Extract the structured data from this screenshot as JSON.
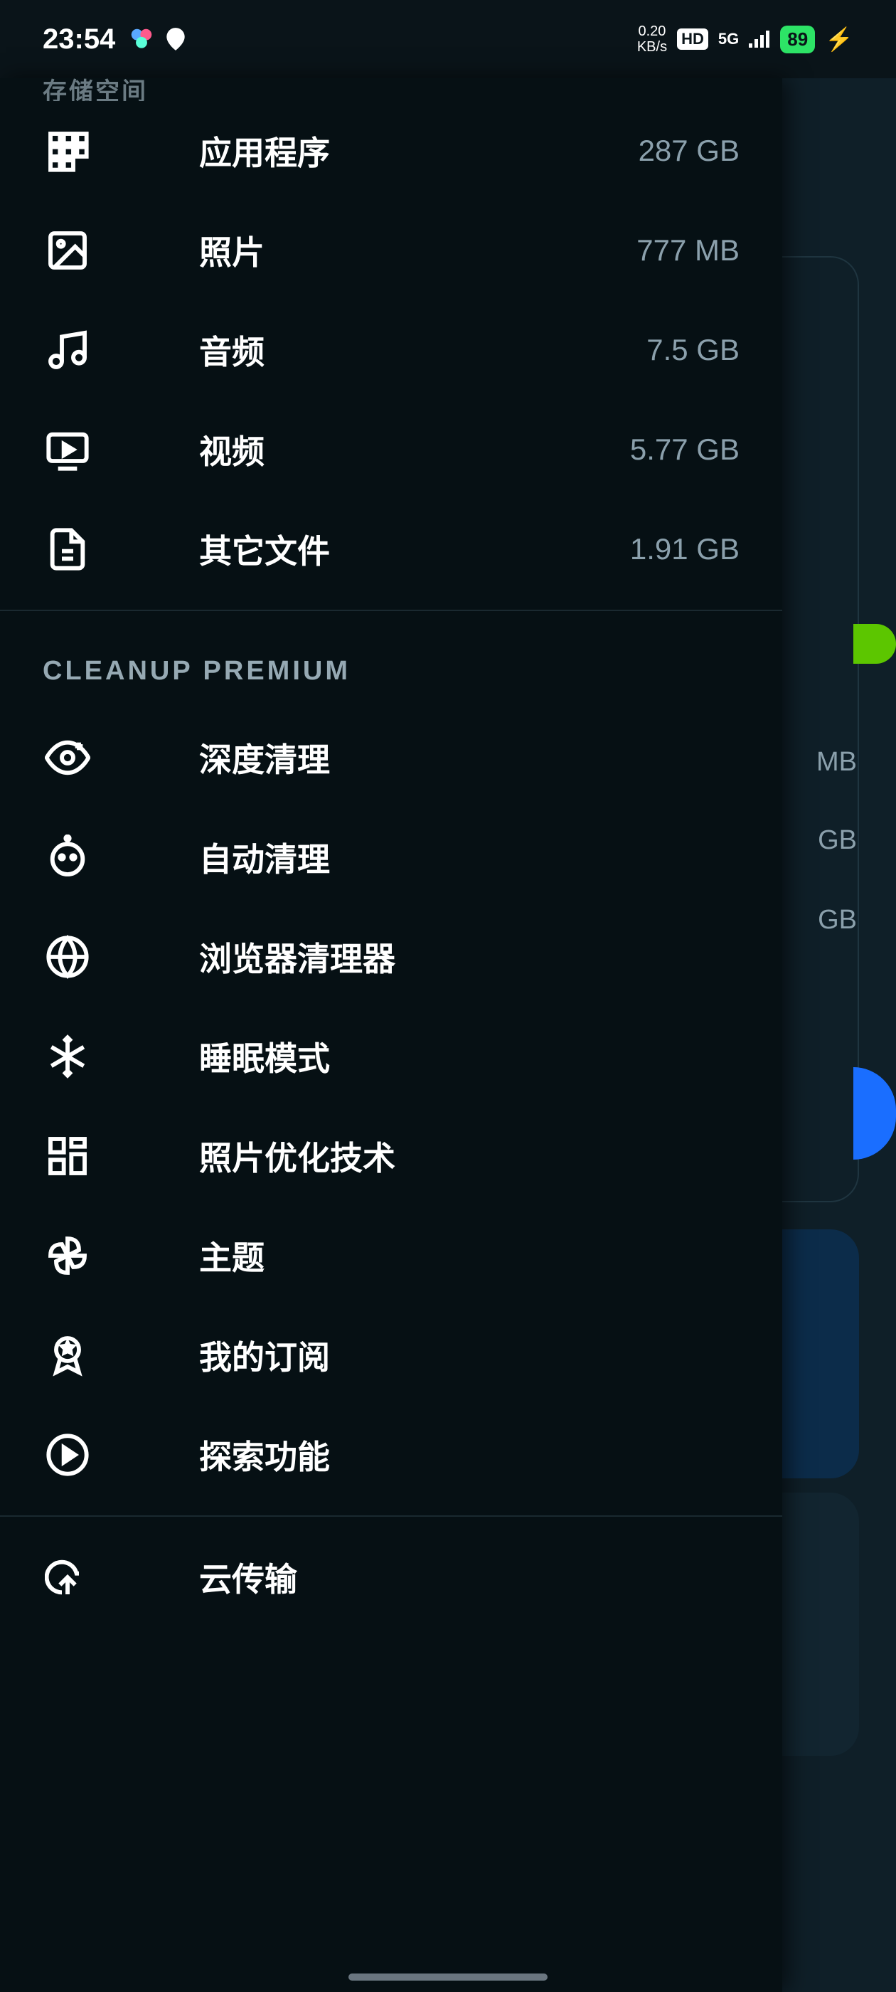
{
  "status_bar": {
    "time": "23:54",
    "speed_upper": "0.20",
    "speed_lower": "KB/s",
    "hd": "HD",
    "network": "5G",
    "battery": "89"
  },
  "background": {
    "text1": "MB",
    "text2": "GB",
    "text3": "GB"
  },
  "drawer": {
    "section_cut": "存储空间",
    "storage_items": [
      {
        "icon": "apps",
        "label": "应用程序",
        "value": "287 GB"
      },
      {
        "icon": "photo",
        "label": "照片",
        "value": "777 MB"
      },
      {
        "icon": "audio",
        "label": "音频",
        "value": "7.5 GB"
      },
      {
        "icon": "video",
        "label": "视频",
        "value": "5.77 GB"
      },
      {
        "icon": "file",
        "label": "其它文件",
        "value": "1.91 GB"
      }
    ],
    "premium_header": "CLEANUP PREMIUM",
    "premium_items": [
      {
        "icon": "eye",
        "label": "深度清理"
      },
      {
        "icon": "robot",
        "label": "自动清理"
      },
      {
        "icon": "globe",
        "label": "浏览器清理器"
      },
      {
        "icon": "snowflake",
        "label": "睡眠模式"
      },
      {
        "icon": "dash",
        "label": "照片优化技术"
      },
      {
        "icon": "pinwheel",
        "label": "主题"
      },
      {
        "icon": "badge",
        "label": "我的订阅"
      },
      {
        "icon": "play",
        "label": "探索功能"
      }
    ],
    "cloud_item": {
      "icon": "cloud",
      "label": "云传输"
    }
  }
}
